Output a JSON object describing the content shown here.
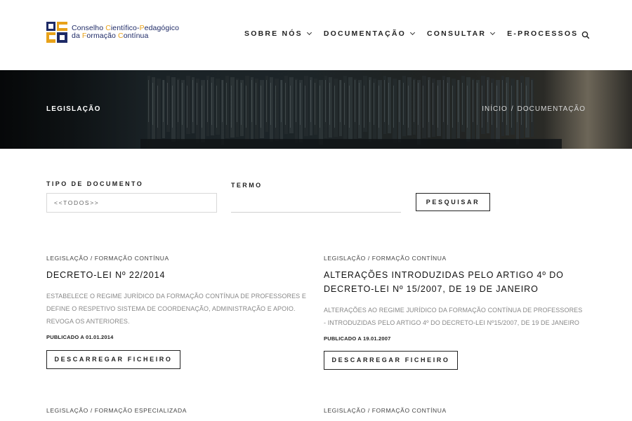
{
  "header": {
    "logo_line1_a": "Conselho ",
    "logo_line1_b": "C",
    "logo_line1_c": "ientífico-",
    "logo_line1_d": "P",
    "logo_line1_e": "edagógico",
    "logo_line2_a": "da ",
    "logo_line2_b": "F",
    "logo_line2_c": "ormação ",
    "logo_line2_d": "C",
    "logo_line2_e": "ontínua",
    "nav": [
      {
        "label": "SOBRE NÓS"
      },
      {
        "label": "DOCUMENTAÇÃO"
      },
      {
        "label": "CONSULTAR"
      },
      {
        "label": "E-PROCESSOS"
      }
    ],
    "colors": {
      "navy": "#1e2a66",
      "gold": "#e8a21a"
    }
  },
  "hero": {
    "title": "LEGISLAÇÃO",
    "breadcrumb": [
      "INÍCIO",
      "/",
      "DOCUMENTAÇÃO"
    ]
  },
  "search": {
    "type_label": "TIPO DE DOCUMENTO",
    "type_value": "<<TODOS>>",
    "term_label": "TERMO",
    "term_value": "",
    "button_label": "PESQUISAR"
  },
  "documents": [
    {
      "category": "LEGISLAÇÃO / FORMAÇÃO CONTÍNUA",
      "title": "DECRETO-LEI Nº 22/2014",
      "description": "ESTABELECE O REGIME JURÍDICO DA FORMAÇÃO CONTÍNUA DE PROFESSORES E DEFINE O RESPETIVO SISTEMA DE COORDENAÇÃO, ADMINISTRAÇÃO E APOIO. REVOGA OS ANTERIORES.",
      "published": "PUBLICADO A 01.01.2014",
      "button": "DESCARREGAR FICHEIRO"
    },
    {
      "category": "LEGISLAÇÃO / FORMAÇÃO CONTÍNUA",
      "title": "ALTERAÇÕES INTRODUZIDAS PELO ARTIGO 4º DO DECRETO-LEI Nº 15/2007, DE 19 DE JANEIRO",
      "description": "ALTERAÇÕES AO REGIME JURÍDICO DA FORMAÇÃO CONTÍNUA DE PROFESSORES - INTRODUZIDAS PELO ARTIGO 4º DO DECRETO-LEI Nº15/2007, DE 19 DE JANEIRO",
      "published": "PUBLICADO A 19.01.2007",
      "button": "DESCARREGAR FICHEIRO"
    },
    {
      "category": "LEGISLAÇÃO / FORMAÇÃO ESPECIALIZADA"
    },
    {
      "category": "LEGISLAÇÃO / FORMAÇÃO CONTÍNUA"
    }
  ]
}
